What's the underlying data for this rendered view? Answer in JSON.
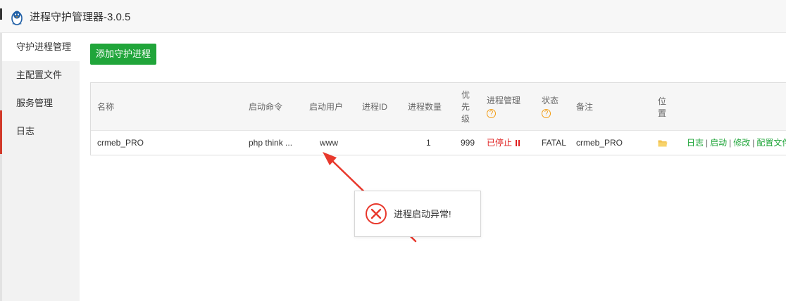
{
  "window": {
    "title": "进程守护管理器-3.0.5",
    "logo_icon": "penguin-icon"
  },
  "sidebar": {
    "items": [
      {
        "label": "守护进程管理",
        "active": true
      },
      {
        "label": "主配置文件",
        "active": false
      },
      {
        "label": "服务管理",
        "active": false
      },
      {
        "label": "日志",
        "active": false
      }
    ]
  },
  "toolbar": {
    "add_label": "添加守护进程"
  },
  "table": {
    "headers": {
      "name": "名称",
      "command": "启动命令",
      "user": "启动用户",
      "pid": "进程ID",
      "count": "进程数量",
      "priority": [
        "优",
        "先",
        "级"
      ],
      "manage": "进程管理",
      "status": "状态",
      "remark": "备注",
      "location": [
        "位",
        "置"
      ]
    },
    "rows": [
      {
        "name": "crmeb_PRO",
        "command": "php think ...",
        "user": "www",
        "pid": "",
        "count": "1",
        "priority": "999",
        "manage": "已停止",
        "status": "FATAL",
        "remark": "crmeb_PRO",
        "location_icon": "folder-icon",
        "actions": [
          "日志",
          "启动",
          "修改",
          "配置文件"
        ]
      }
    ]
  },
  "toast": {
    "message": "进程启动异常!",
    "icon": "error-icon"
  },
  "colors": {
    "accent": "#20a53a",
    "danger": "#e02020",
    "help": "#f39c12",
    "arrow": "#e8382c"
  }
}
